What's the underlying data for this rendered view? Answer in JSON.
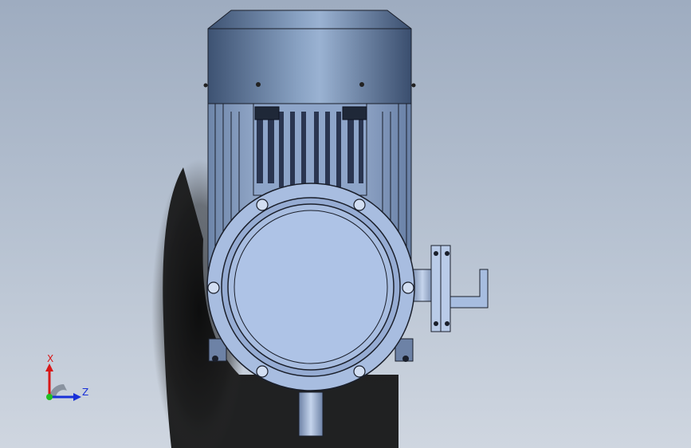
{
  "viewport": {
    "background_top": "#9eacc0",
    "background_bottom": "#cfd6e0"
  },
  "model": {
    "part_color": "#a8bde0",
    "housing_color": "#5f7595",
    "fan_cover_color": "#6f86a6",
    "edge_color": "#1a1f2b"
  },
  "triad": {
    "x_label": "X",
    "z_label": "Z",
    "x_color": "#d81818",
    "z_color": "#1830d8",
    "y_color": "#20c020"
  }
}
